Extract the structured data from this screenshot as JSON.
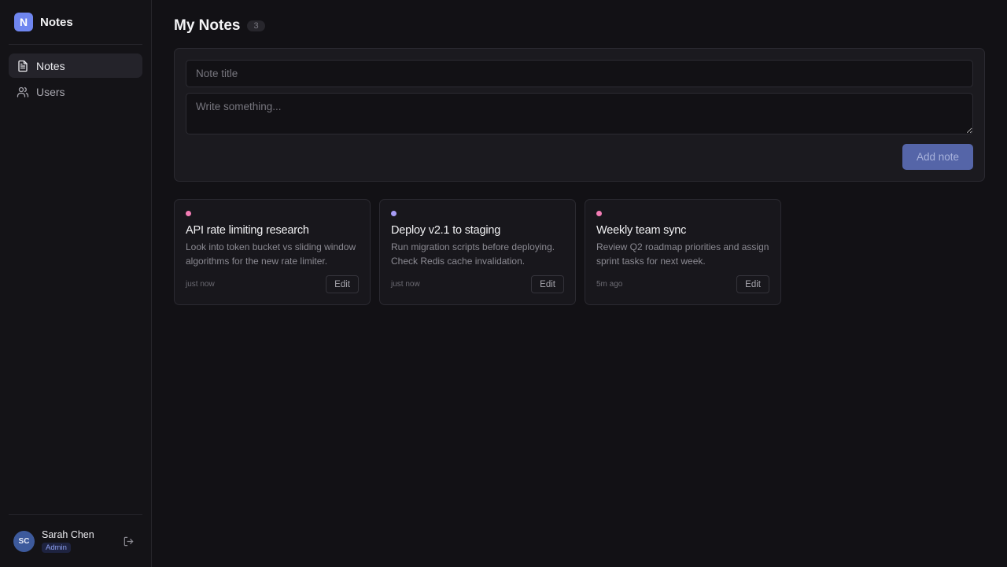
{
  "app": {
    "logo_letter": "N",
    "name": "Notes",
    "accent": "#6f86f0"
  },
  "sidebar": {
    "items": [
      {
        "label": "Notes",
        "icon": "document-icon",
        "active": true
      },
      {
        "label": "Users",
        "icon": "users-icon",
        "active": false
      }
    ]
  },
  "user": {
    "initials": "SC",
    "name": "Sarah Chen",
    "role": "Admin"
  },
  "header": {
    "title": "My Notes",
    "count": "3"
  },
  "composer": {
    "title_placeholder": "Note title",
    "body_placeholder": "Write something...",
    "add_label": "Add note"
  },
  "notes": [
    {
      "title": "API rate limiting research",
      "body": "Look into token bucket vs sliding window algorithms for the new rate limiter.",
      "time": "just now",
      "edit_label": "Edit",
      "dot_color": "#f27cb4"
    },
    {
      "title": "Deploy v2.1 to staging",
      "body": "Run migration scripts before deploying. Check Redis cache invalidation.",
      "time": "just now",
      "edit_label": "Edit",
      "dot_color": "#a79cf5"
    },
    {
      "title": "Weekly team sync",
      "body": "Review Q2 roadmap priorities and assign sprint tasks for next week.",
      "time": "5m ago",
      "edit_label": "Edit",
      "dot_color": "#f27cb4"
    }
  ]
}
